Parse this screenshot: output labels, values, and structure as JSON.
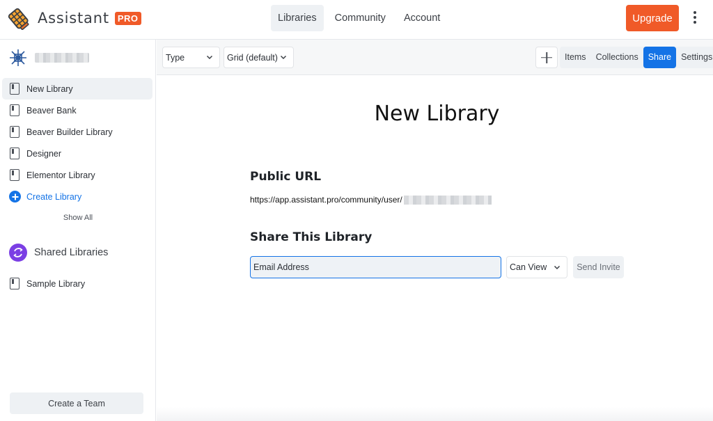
{
  "header": {
    "brand_name": "Assistant",
    "brand_badge": "PRO",
    "nav": [
      {
        "label": "Libraries",
        "active": true
      },
      {
        "label": "Community",
        "active": false
      },
      {
        "label": "Account",
        "active": false
      }
    ],
    "upgrade_label": "Upgrade"
  },
  "sidebar": {
    "libraries": [
      {
        "label": "New Library",
        "active": true
      },
      {
        "label": "Beaver Bank",
        "active": false
      },
      {
        "label": "Beaver Builder Library",
        "active": false
      },
      {
        "label": "Designer",
        "active": false
      },
      {
        "label": "Elementor Library",
        "active": false
      }
    ],
    "create_library_label": "Create Library",
    "show_all_label": "Show All",
    "shared_title": "Shared Libraries",
    "shared_libraries": [
      {
        "label": "Sample Library"
      }
    ],
    "create_team_label": "Create a Team"
  },
  "toolbar": {
    "type_select": "Type",
    "view_select": "Grid (default)",
    "tabs": [
      {
        "label": "Items",
        "active": false
      },
      {
        "label": "Collections",
        "active": false
      },
      {
        "label": "Share",
        "active": true
      },
      {
        "label": "Settings",
        "active": false
      }
    ]
  },
  "main": {
    "title": "New Library",
    "public_url_title": "Public URL",
    "public_url": "https://app.assistant.pro/community/user/",
    "share_title": "Share This Library",
    "email_placeholder": "Email Address",
    "permission": "Can View",
    "send_invite_label": "Send Invite"
  },
  "colors": {
    "accent": "#1473e6",
    "brand": "#f05a28",
    "shared_icon": "#7b3fe4"
  }
}
